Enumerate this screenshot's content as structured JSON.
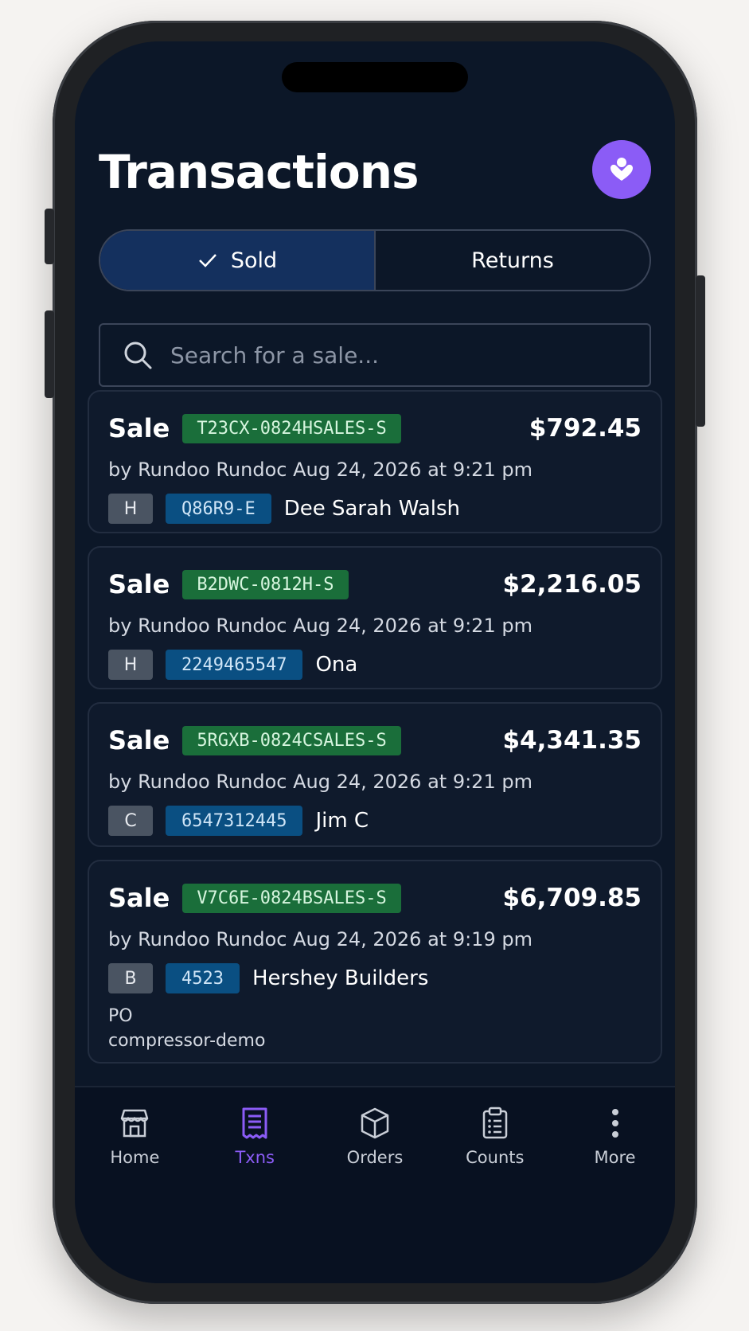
{
  "header": {
    "title": "Transactions"
  },
  "segmented": {
    "sold_label": "Sold",
    "returns_label": "Returns"
  },
  "search": {
    "placeholder": "Search for a sale..."
  },
  "transactions": [
    {
      "type": "Sale",
      "id": "T23CX-0824HSALES-S",
      "amount": "$792.45",
      "byline": "by Rundoo Rundoc Aug 24, 2026 at 9:21 pm",
      "letter": "H",
      "account": "Q86R9-E",
      "customer": "Dee Sarah Walsh"
    },
    {
      "type": "Sale",
      "id": "B2DWC-0812H-S",
      "amount": "$2,216.05",
      "byline": "by Rundoo Rundoc Aug 24, 2026 at 9:21 pm",
      "letter": "H",
      "account": "2249465547",
      "customer": "Ona"
    },
    {
      "type": "Sale",
      "id": "5RGXB-0824CSALES-S",
      "amount": "$4,341.35",
      "byline": "by Rundoo Rundoc Aug 24, 2026 at 9:21 pm",
      "letter": "C",
      "account": "6547312445",
      "customer": "Jim C"
    },
    {
      "type": "Sale",
      "id": "V7C6E-0824BSALES-S",
      "amount": "$6,709.85",
      "byline": "by Rundoo Rundoc Aug 24, 2026 at 9:19 pm",
      "letter": "B",
      "account": "4523",
      "customer": "Hershey Builders",
      "po_label": "PO",
      "po_value": "compressor-demo"
    }
  ],
  "nav": {
    "items": [
      {
        "label": "Home",
        "icon": "store-icon"
      },
      {
        "label": "Txns",
        "icon": "receipt-icon",
        "active": true
      },
      {
        "label": "Orders",
        "icon": "box-icon"
      },
      {
        "label": "Counts",
        "icon": "clipboard-icon"
      },
      {
        "label": "More",
        "icon": "more-vertical-icon"
      }
    ]
  },
  "colors": {
    "accent": "#8b5cf6",
    "background": "#0c1728",
    "tag_green": "#1a6e3a",
    "tag_blue": "#0a4f82",
    "tag_grey": "#4a5462"
  }
}
